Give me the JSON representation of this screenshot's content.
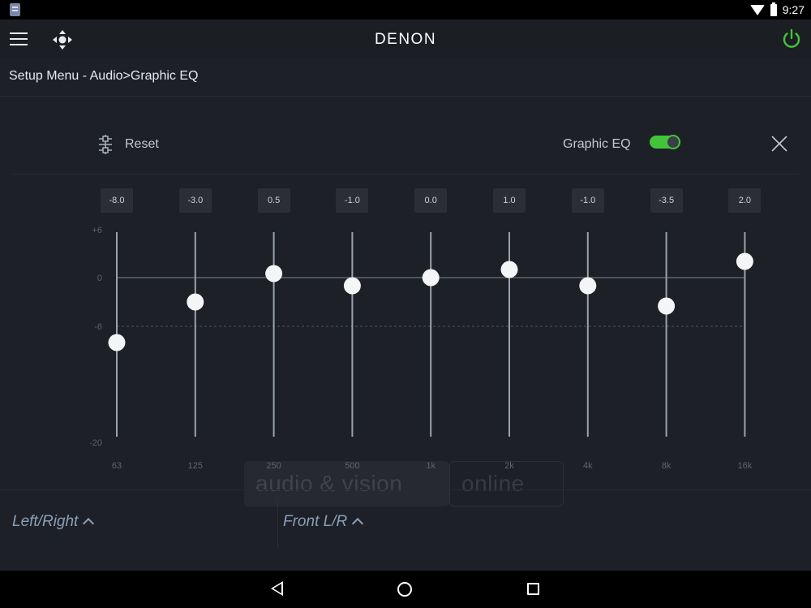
{
  "status_bar": {
    "time": "9:27"
  },
  "app_bar": {
    "brand": "DENON",
    "menu_icon": "menu-icon",
    "move_icon": "move-icon",
    "power_icon": "power-icon",
    "power_color": "#43c43a"
  },
  "breadcrumb": "Setup Menu - Audio>Graphic EQ",
  "toolbar": {
    "reset_label": "Reset",
    "eq_label": "Graphic EQ",
    "eq_enabled": true,
    "accent": "#43c43a"
  },
  "eq": {
    "y_axis_labels": [
      "+6",
      "0",
      "-6",
      "-20"
    ],
    "y_axis_values": [
      6,
      0,
      -6,
      -20
    ],
    "bands": [
      {
        "freq": "63",
        "value": -8.0,
        "label": "-8.0"
      },
      {
        "freq": "125",
        "value": -3.0,
        "label": "-3.0"
      },
      {
        "freq": "250",
        "value": 0.5,
        "label": "0.5"
      },
      {
        "freq": "500",
        "value": -1.0,
        "label": "-1.0"
      },
      {
        "freq": "1k",
        "value": 0.0,
        "label": "0.0"
      },
      {
        "freq": "2k",
        "value": 1.0,
        "label": "1.0"
      },
      {
        "freq": "4k",
        "value": -1.0,
        "label": "-1.0"
      },
      {
        "freq": "8k",
        "value": -3.5,
        "label": "-3.5"
      },
      {
        "freq": "16k",
        "value": 2.0,
        "label": "2.0"
      }
    ]
  },
  "watermark": {
    "text_a": "audio & vision",
    "text_b": "online"
  },
  "channels": {
    "left": "Left/Right",
    "right": "Front L/R"
  }
}
